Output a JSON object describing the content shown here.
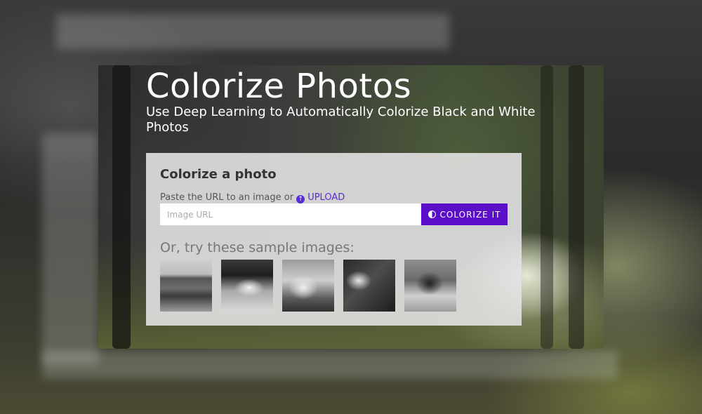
{
  "hero": {
    "title": "Colorize Photos",
    "subtitle": "Use Deep Learning to Automatically Colorize Black and White Photos"
  },
  "panel": {
    "title": "Colorize a photo",
    "url_hint_prefix": "Paste the URL to an image or",
    "upload_label": "UPLOAD",
    "input_placeholder": "Image URL",
    "colorize_button": "COLORIZE IT",
    "samples_label": "Or, try these sample images:",
    "samples": [
      {
        "subject": "heron in water"
      },
      {
        "subject": "sprint car racing"
      },
      {
        "subject": "mountain climber"
      },
      {
        "subject": "man with smoke"
      },
      {
        "subject": "cow in grass"
      }
    ]
  },
  "colors": {
    "accent": "#5a0ec8",
    "link": "#5b2bd6",
    "panel_bg": "#e2e2e2"
  }
}
